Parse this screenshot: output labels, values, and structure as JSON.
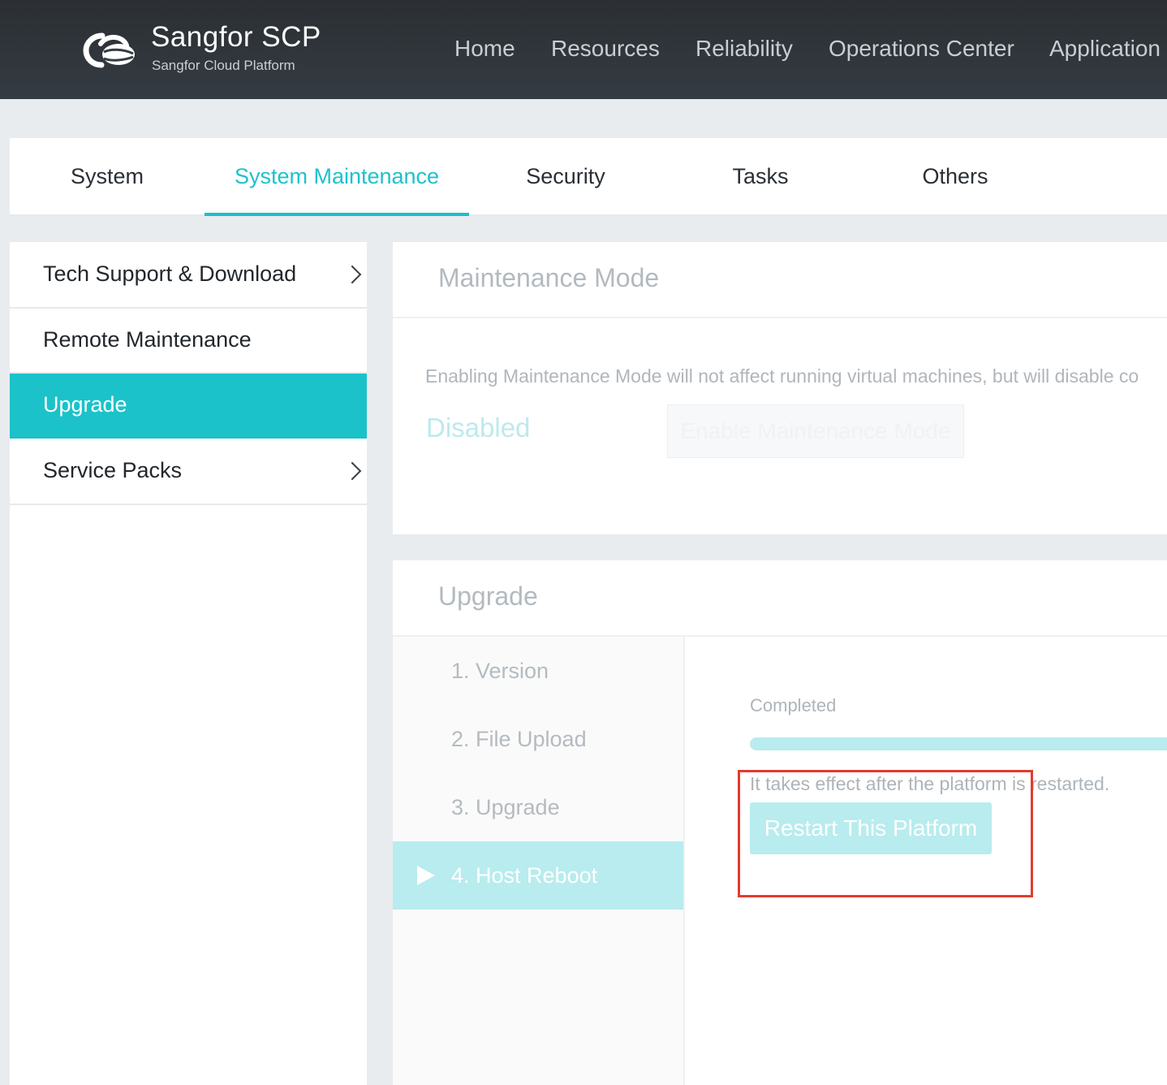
{
  "brand": {
    "title": "Sangfor SCP",
    "subtitle": "Sangfor Cloud Platform",
    "logo_icon": "cloud-logo-icon"
  },
  "top_nav": [
    "Home",
    "Resources",
    "Reliability",
    "Operations Center",
    "Application"
  ],
  "tabs": [
    {
      "label": "System",
      "active": false
    },
    {
      "label": "System Maintenance",
      "active": true
    },
    {
      "label": "Security",
      "active": false
    },
    {
      "label": "Tasks",
      "active": false
    },
    {
      "label": "Others",
      "active": false
    }
  ],
  "sidebar": {
    "items": [
      {
        "label": "Tech Support & Download",
        "icon": "chevron-right-icon",
        "active": false
      },
      {
        "label": "Remote Maintenance",
        "active": false
      },
      {
        "label": "Upgrade",
        "active": true
      },
      {
        "label": "Service Packs",
        "icon": "chevron-right-icon",
        "active": false
      }
    ]
  },
  "maintenance_mode": {
    "title": "Maintenance Mode",
    "description": "Enabling Maintenance Mode will not affect running virtual machines, but will disable co",
    "status": "Disabled",
    "button_label": "Enable Maintenance Mode"
  },
  "upgrade": {
    "title": "Upgrade",
    "steps": [
      {
        "label": "1. Version",
        "active": false
      },
      {
        "label": "2. File Upload",
        "active": false
      },
      {
        "label": "3. Upgrade",
        "active": false
      },
      {
        "label": "4. Host Reboot",
        "active": true,
        "icon": "play-icon"
      }
    ],
    "progress_label": "Completed",
    "progress_percent": 100,
    "note": "It takes effect after the platform is restarted.",
    "restart_button": "Restart This Platform"
  },
  "colors": {
    "accent": "#1bc2c9",
    "accent_light": "#b8ecee",
    "header_bg": "#2f353a",
    "highlight": "#e23b2e"
  }
}
